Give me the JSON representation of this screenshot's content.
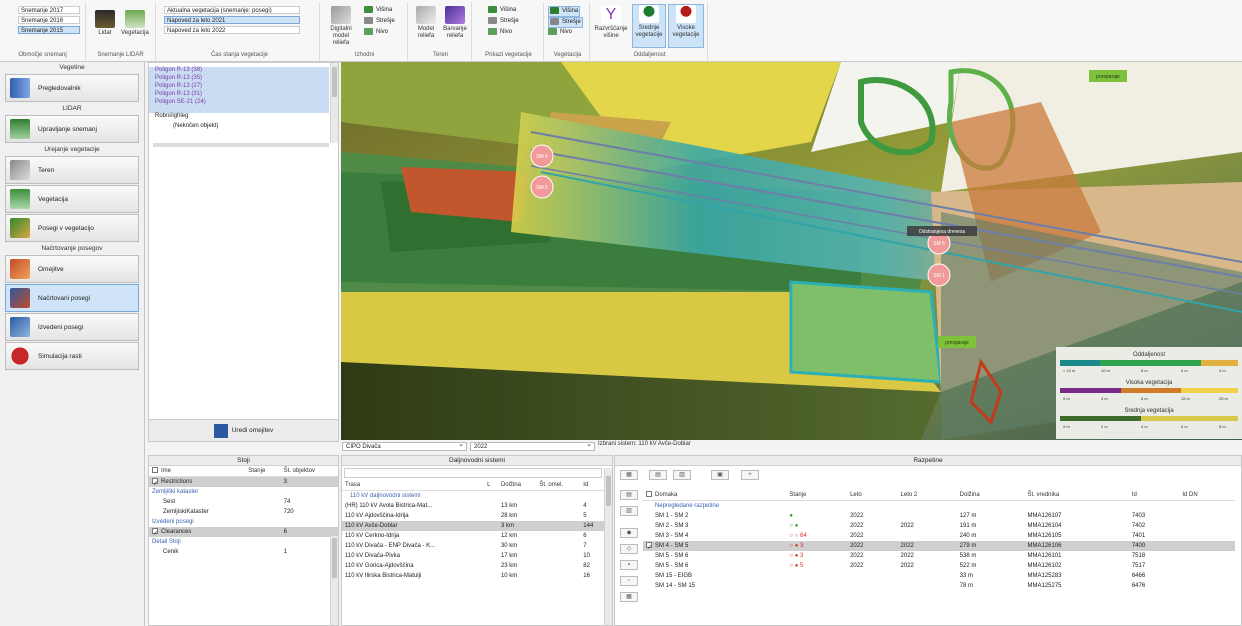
{
  "ribbon": {
    "snapshots": [
      "Snemanje 2017",
      "Snemanje 2016",
      "Snemanje 2015"
    ],
    "snapshots_group": "Območje snemanj",
    "lidar_group": "Snemanje LIDAR",
    "lidar_btn": "Lidar",
    "veg_btn": "Vegetacija",
    "veg_states": [
      "Aktualna vegetacija (snemanje: posegi)",
      "Napoved za leto 2021",
      "Napoved za leto 2022"
    ],
    "veg_state_group": "Čas stanja vegetacije",
    "dig_btn": "Digitalni model reliefa",
    "height_items": [
      "Višina",
      "Strešje",
      "Nivo"
    ],
    "adjust_group": "Izhodni",
    "terrain_btns": [
      "Model reliefa",
      "Barvanje reliefa"
    ],
    "terrain_group": "Teren",
    "veg_height_items": [
      "Višina",
      "Strešje",
      "Nivo"
    ],
    "veg_height_group": "Prikazi vegetacije",
    "vegetation_items": [
      "Višina",
      "Strešje",
      "Nivo"
    ],
    "vegetation_group": "Vegetacija",
    "dist_btns": [
      "Razvrščanje višine",
      "Srednje vegetacije",
      "Visoke vegetacije"
    ],
    "dist_group": "Oddaljenost"
  },
  "leftnav": {
    "sections": [
      {
        "header": "Vegetine",
        "items": [
          "Pregledovalnik"
        ]
      },
      {
        "header": "LIDAR",
        "items": [
          "Upravljanje snemanj"
        ]
      },
      {
        "header": "Urejanje vegetacije",
        "items": [
          "Teren",
          "Vegetacija",
          "Posegi v vegetacijo"
        ]
      },
      {
        "header": "Načrtovanje posegov",
        "items": [
          "Omejitve",
          "Načrtovani posegi",
          "Izvedeni posegi",
          "Simulacija rasti"
        ]
      }
    ],
    "active": "Načrtovani posegi"
  },
  "tree": {
    "items": [
      "Poligon R-13 (38)",
      "Poligon R-13 (35)",
      "Poligon R-13 (27)",
      "Poligon R-13 (31)",
      "Poligon SE-21 (24)",
      "Robni/ighleg",
      "(Neknčen objekt)"
    ],
    "button": "Uredi omejitev"
  },
  "map": {
    "labels": [
      "SM 4",
      "SM 5",
      "SM 5",
      "SM 1",
      "presparaje",
      "presparaje",
      "Odstranjena drevesa"
    ],
    "legend": [
      {
        "title": "Oddaljenost",
        "ticks": [
          "< 10 m",
          "10 m",
          "8 m",
          "6 m",
          "4 m"
        ]
      },
      {
        "title": "Visoka vegetacija",
        "ticks": [
          "0 m",
          "4 m",
          "8 m",
          "15 m",
          "25 m"
        ]
      },
      {
        "title": "Srednja vegetacija",
        "ticks": [
          "0 m",
          "2 m",
          "4 m",
          "6 m",
          "8 m"
        ]
      }
    ]
  },
  "bottom_left": {
    "header": "Stoji",
    "cols": [
      "Ime",
      "Stanje",
      "Št. objektov"
    ],
    "rows": [
      {
        "type": "row",
        "check": true,
        "name": "Restrictions",
        "state": "",
        "count": "3",
        "sel": true
      },
      {
        "type": "grp",
        "name": "Zemljiški kataster"
      },
      {
        "type": "row",
        "check": false,
        "name": "Sest",
        "state": "",
        "count": "74"
      },
      {
        "type": "row",
        "check": false,
        "name": "ZemljiskiKataster",
        "state": "",
        "count": "720"
      },
      {
        "type": "grp",
        "name": "Izvedeni posegi"
      },
      {
        "type": "row",
        "check": true,
        "name": "Clearances",
        "state": "",
        "count": "6",
        "sel": true
      },
      {
        "type": "grp",
        "name": "Detail Stoji"
      },
      {
        "type": "row",
        "check": false,
        "name": "Cenik",
        "state": "",
        "count": "1"
      }
    ]
  },
  "bottom_mid": {
    "combo1": "CIPO Divača",
    "combo2": "2022",
    "header": "Daljnovodni sistemi",
    "cols": [
      "Trasa",
      "L",
      "Dolžina",
      "Št. omel.",
      "Id"
    ],
    "group": "110 kV daljnovodni sistemi",
    "rows": [
      {
        "name": "(HR) 110 kV Avola Bistrica-Mat...",
        "len": "13 km",
        "id": "4"
      },
      {
        "name": "110 kV Ajdovščina-Idrija",
        "len": "28 km",
        "id": "5"
      },
      {
        "name": "110 kV Avče-Doblar",
        "len": "3 km",
        "id": "144",
        "sel": true
      },
      {
        "name": "110 kV Cerkno-Idrija",
        "len": "12 km",
        "id": "6"
      },
      {
        "name": "110 kV Divača - ENP Divača - K...",
        "len": "30 km",
        "id": "7"
      },
      {
        "name": "110 kV Divača-Pivka",
        "len": "17 km",
        "id": "10"
      },
      {
        "name": "110 kV Gorica-Ajdovščina",
        "len": "23 km",
        "id": "82"
      },
      {
        "name": "110 kV Ilirska Bistrica-Matulji",
        "len": "10 km",
        "id": "16"
      }
    ]
  },
  "bottom_right": {
    "title": "Izbrani sistem: 110 kV Avče-Doblar",
    "header": "Razpetine",
    "cols": [
      "Domaka",
      "Stanje",
      "Leto",
      "Leto 2",
      "Dolžina",
      "Št. vrednika",
      "Id",
      "Id DN"
    ],
    "group": "Nepregledane razpetine",
    "rows": [
      {
        "name": "SM 1 - SM 2",
        "state": "●",
        "stclass": "stat-g",
        "y1": "2022",
        "y2": "",
        "len": "127 m",
        "code": "MMA126107",
        "id": "7403"
      },
      {
        "name": "SM 2 - SM 3",
        "state": "○ ●",
        "stclass": "stat-g",
        "y1": "2022",
        "y2": "2022",
        "len": "191 m",
        "code": "MMA126104",
        "id": "7402"
      },
      {
        "name": "SM 3 - SM 4",
        "state": "○ ○ 64",
        "stclass": "stat-r",
        "y1": "2022",
        "y2": "",
        "len": "240 m",
        "code": "MMA126105",
        "id": "7401"
      },
      {
        "name": "SM 4 - SM 5",
        "state": "○ ● 3",
        "stclass": "stat-r",
        "y1": "2022",
        "y2": "2022",
        "len": "279 m",
        "code": "MMA126106",
        "id": "7400",
        "sel": true
      },
      {
        "name": "SM 5 - SM 6",
        "state": "○ ● 3",
        "stclass": "stat-r",
        "y1": "2022",
        "y2": "2022",
        "len": "538 m",
        "code": "MMA126101",
        "id": "7518"
      },
      {
        "name": "SM 5 - SM 6",
        "state": "○ ● 5",
        "stclass": "stat-r",
        "y1": "2022",
        "y2": "2022",
        "len": "522 m",
        "code": "MMA126102",
        "id": "7517"
      },
      {
        "name": "SM 15 - EIGB",
        "state": "",
        "stclass": "",
        "y1": "",
        "y2": "",
        "len": "33 m",
        "code": "MMA125283",
        "id": "6466"
      },
      {
        "name": "SM 14 - SM 15",
        "state": "",
        "stclass": "",
        "y1": "",
        "y2": "",
        "len": "78 m",
        "code": "MMA125275",
        "id": "6476"
      }
    ]
  }
}
